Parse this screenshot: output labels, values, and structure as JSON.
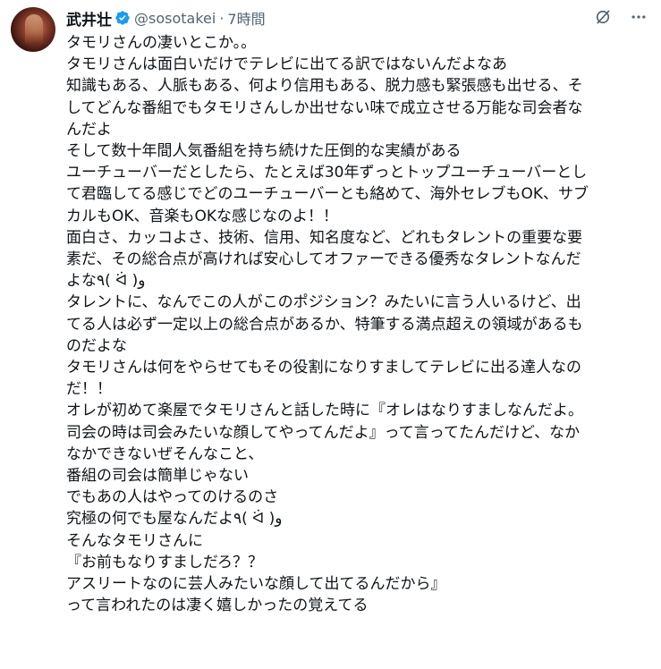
{
  "author": {
    "name": "武井壮",
    "handle": "@sosotakei",
    "separator": "·",
    "time": "7時間",
    "verified": true
  },
  "icons": {
    "avatar": "profile-photo",
    "verified": "verified-badge-icon",
    "grok": "grok-icon",
    "more": "more-icon"
  },
  "colors": {
    "verified_blue": "#1d9bf0",
    "text_primary": "#0f1419",
    "text_secondary": "#536471"
  },
  "tweet": {
    "lines": [
      "タモリさんの凄いとこか。。",
      "タモリさんは面白いだけでテレビに出てる訳ではないんだよなあ",
      "知識もある、人脈もある、何より信用もある、脱力感も緊張感も出せる、そ",
      "してどんな番組でもタモリさんしか出せない味で成立させる万能な司会者な",
      "んだよ",
      "そして数十年間人気番組を持ち続けた圧倒的な実績がある",
      "ユーチューバーだとしたら、たとえば30年ずっとトップユーチューバーとし",
      "て君臨してる感じでどのユーチューバーとも絡めて、海外セレブもOK、サブ",
      "カルもOK、音楽もOKな感じなのよ！！",
      "面白さ、カッコよさ、技術、信用、知名度など、どれもタレントの重要な要",
      "素だ、その総合点が高ければ安心してオファーできる優秀なタレントなんだ",
      "よな٩( ᐛ )و",
      "タレントに、なんでこの人がこのポジション？みたいに言う人いるけど、出",
      "てる人は必ず一定以上の総合点があるか、特筆する満点超えの領域があるも",
      "のだよな",
      "タモリさんは何をやらせてもその役割になりすましてテレビに出る達人なの",
      "だ！！",
      "オレが初めて楽屋でタモリさんと話した時に『オレはなりすましなんだよ。",
      "司会の時は司会みたいな顔してやってんだよ』って言ってたんだけど、なか",
      "なかできないぜそんなこと、",
      "番組の司会は簡単じゃない",
      "でもあの人はやってのけるのさ",
      "究極の何でも屋なんだよ٩( ᐛ )و",
      "そんなタモリさんに",
      "『お前もなりすましだろ？？",
      "アスリートなのに芸人みたいな顔して出てるんだから』",
      "って言われたのは凄く嬉しかったの覚えてる"
    ]
  }
}
